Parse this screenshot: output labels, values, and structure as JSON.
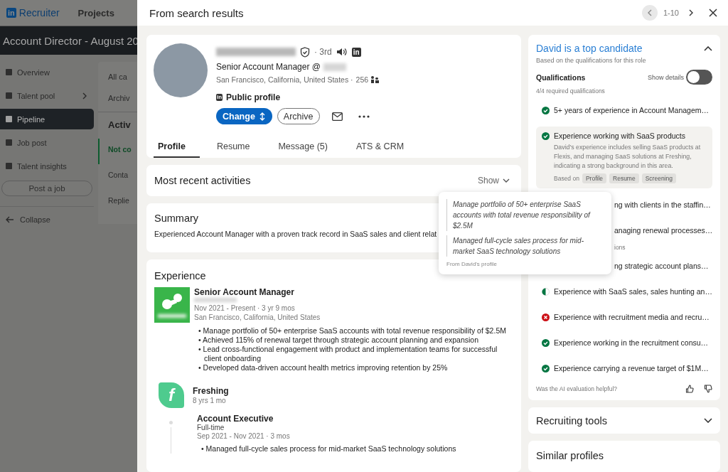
{
  "background_app": {
    "logo_mark": "in",
    "product": "Recruiter",
    "top_nav": [
      "Projects"
    ],
    "project_title": "Account Director - August 20",
    "sidebar": {
      "items": [
        {
          "label": "Overview",
          "selected": false,
          "submenu": false
        },
        {
          "label": "Talent pool",
          "selected": false,
          "submenu": true
        },
        {
          "label": "Pipeline",
          "selected": true,
          "submenu": false
        },
        {
          "label": "Job post",
          "selected": false,
          "submenu": false
        },
        {
          "label": "Talent insights",
          "selected": false,
          "submenu": false
        }
      ],
      "post_button": "Post a job",
      "collapse": "Collapse"
    },
    "pipeline": {
      "filters": [
        "All ca",
        "Archiv"
      ],
      "heading": "Activ",
      "stages": [
        {
          "label": "Not co",
          "selected": true
        },
        {
          "label": "Conta",
          "selected": false
        },
        {
          "label": "Replie",
          "selected": false
        }
      ]
    }
  },
  "panel": {
    "title": "From search results",
    "pager": "1-10",
    "profile": {
      "linkedin_badge": "in",
      "public_profile_badge": "in",
      "degree": "· 3rd",
      "headline": "Senior Account Manager @",
      "location": "San Francisco, California, United States ·",
      "connections": "256",
      "public_profile": "Public profile",
      "change_button": "Change",
      "archive_button": "Archive",
      "tabs": [
        {
          "label": "Profile",
          "selected": true
        },
        {
          "label": "Resume",
          "selected": false
        },
        {
          "label": "Message (5)",
          "selected": false
        },
        {
          "label": "ATS & CRM",
          "selected": false
        }
      ]
    },
    "activities": {
      "title": "Most recent activities",
      "toggle": "Show"
    },
    "summary": {
      "title": "Summary",
      "text": "Experienced Account Manager with a proven track record in SaaS sales and client relat"
    },
    "experience": {
      "title": "Experience",
      "bullet_marker": "•",
      "current": {
        "role": "Senior Account Manager",
        "dates": "Nov 2021 - Present · 3 yr 9 mos",
        "location": "San Francisco, California, United States",
        "bullets": [
          "Manage portfolio of 50+ enterprise SaaS accounts with total revenue responsibility of $2.5M",
          "Achieved 115% of renewal target through strategic account planning and expansion",
          "Lead cross-functional engagement with product and implementation teams for successful client onboarding",
          "Developed data-driven account health metrics improving retention by 25%"
        ]
      },
      "company": {
        "logo_letter": "f",
        "name": "Freshing",
        "tenure": "8 yrs 1 mo",
        "role": "Account Executive",
        "type": "Full-time",
        "dates": "Sep 2021 - Nov 2021 · 3 mos",
        "bullets": [
          "Managed full-cycle sales process for mid-market SaaS technology solutions"
        ]
      }
    }
  },
  "evaluation": {
    "title": "David is a top candidate",
    "subtitle": "Based on the qualifications for this role",
    "section": "Qualifications",
    "show_details": {
      "label": "Show details",
      "on": false
    },
    "count": "4/4 required qualifications",
    "items": [
      {
        "kind": "met",
        "text": "5+ years of experience in Account Managem…"
      },
      {
        "kind": "met_expanded",
        "text": "Experience working with SaaS products",
        "detail": "David's experience includes selling SaaS products at Flexis, and managing SaaS solutions at Freshing, indicating a strong background in this area.",
        "based_on": "Based on",
        "sources": [
          "Profile",
          "Resume",
          "Screening"
        ]
      },
      {
        "kind": "covered",
        "text": "ng with clients in the staffin…"
      },
      {
        "kind": "covered",
        "text": "anaging renewal processes…"
      },
      {
        "kind": "covered_heading",
        "text": "ions"
      },
      {
        "kind": "covered",
        "text": "ng strategic account plans…"
      },
      {
        "kind": "partial",
        "text": "Experience with SaaS sales, sales hunting an…"
      },
      {
        "kind": "unmet",
        "text": "Experience with recruitment media and recru…"
      },
      {
        "kind": "met",
        "text": "Experience working in the recruitment consu…"
      },
      {
        "kind": "met",
        "text": "Experience carrying a revenue target of $1M…"
      }
    ],
    "feedback": "Was the AI evaluation helpful?"
  },
  "recruiting_tools": {
    "title": "Recruiting tools"
  },
  "similar_profiles": {
    "title": "Similar profiles"
  },
  "popover": {
    "quotes": [
      "Manage portfolio of 50+ enterprise SaaS accounts with total revenue responsibility of $2.5M",
      "Managed full-cycle sales process for mid-market SaaS technology solutions"
    ],
    "source": "From David's profile"
  }
}
